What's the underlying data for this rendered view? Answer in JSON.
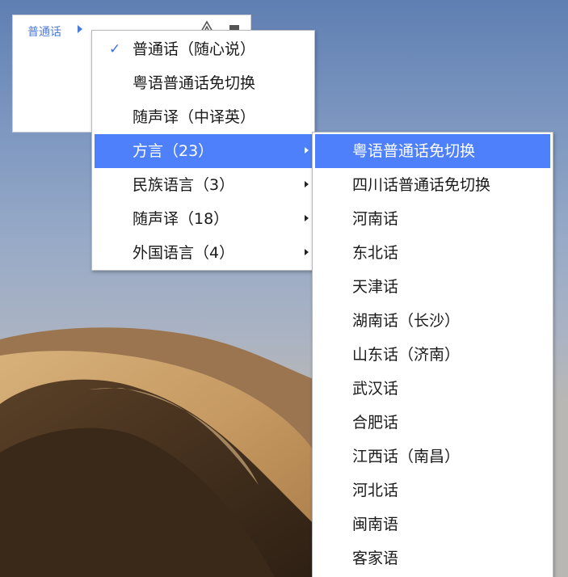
{
  "toolbar": {
    "language_label": "普通话",
    "arrow_icon": "triangle-right-icon",
    "icons": [
      "mountain-icon",
      "minimize-icon"
    ]
  },
  "menu": {
    "items": [
      {
        "label": "普通话（随心说）",
        "checked": true,
        "has_submenu": false
      },
      {
        "label": "粤语普通话免切换",
        "checked": false,
        "has_submenu": false
      },
      {
        "label": "随声译（中译英）",
        "checked": false,
        "has_submenu": false
      },
      {
        "label": "方言（23）",
        "checked": false,
        "has_submenu": true,
        "highlighted": true
      },
      {
        "label": "民族语言（3）",
        "checked": false,
        "has_submenu": true
      },
      {
        "label": "随声译（18）",
        "checked": false,
        "has_submenu": true
      },
      {
        "label": "外国语言（4）",
        "checked": false,
        "has_submenu": true
      }
    ]
  },
  "submenu": {
    "items": [
      {
        "label": "粤语普通话免切换",
        "highlighted": true
      },
      {
        "label": "四川话普通话免切换"
      },
      {
        "label": "河南话"
      },
      {
        "label": "东北话"
      },
      {
        "label": "天津话"
      },
      {
        "label": "湖南话（长沙）"
      },
      {
        "label": "山东话（济南）"
      },
      {
        "label": "武汉话"
      },
      {
        "label": "合肥话"
      },
      {
        "label": "江西话（南昌）"
      },
      {
        "label": "河北话"
      },
      {
        "label": "闽南语"
      },
      {
        "label": "客家语"
      }
    ]
  },
  "colors": {
    "highlight": "#4f80fb",
    "accent_text": "#4b7bd8",
    "check": "#3b6fe0"
  }
}
